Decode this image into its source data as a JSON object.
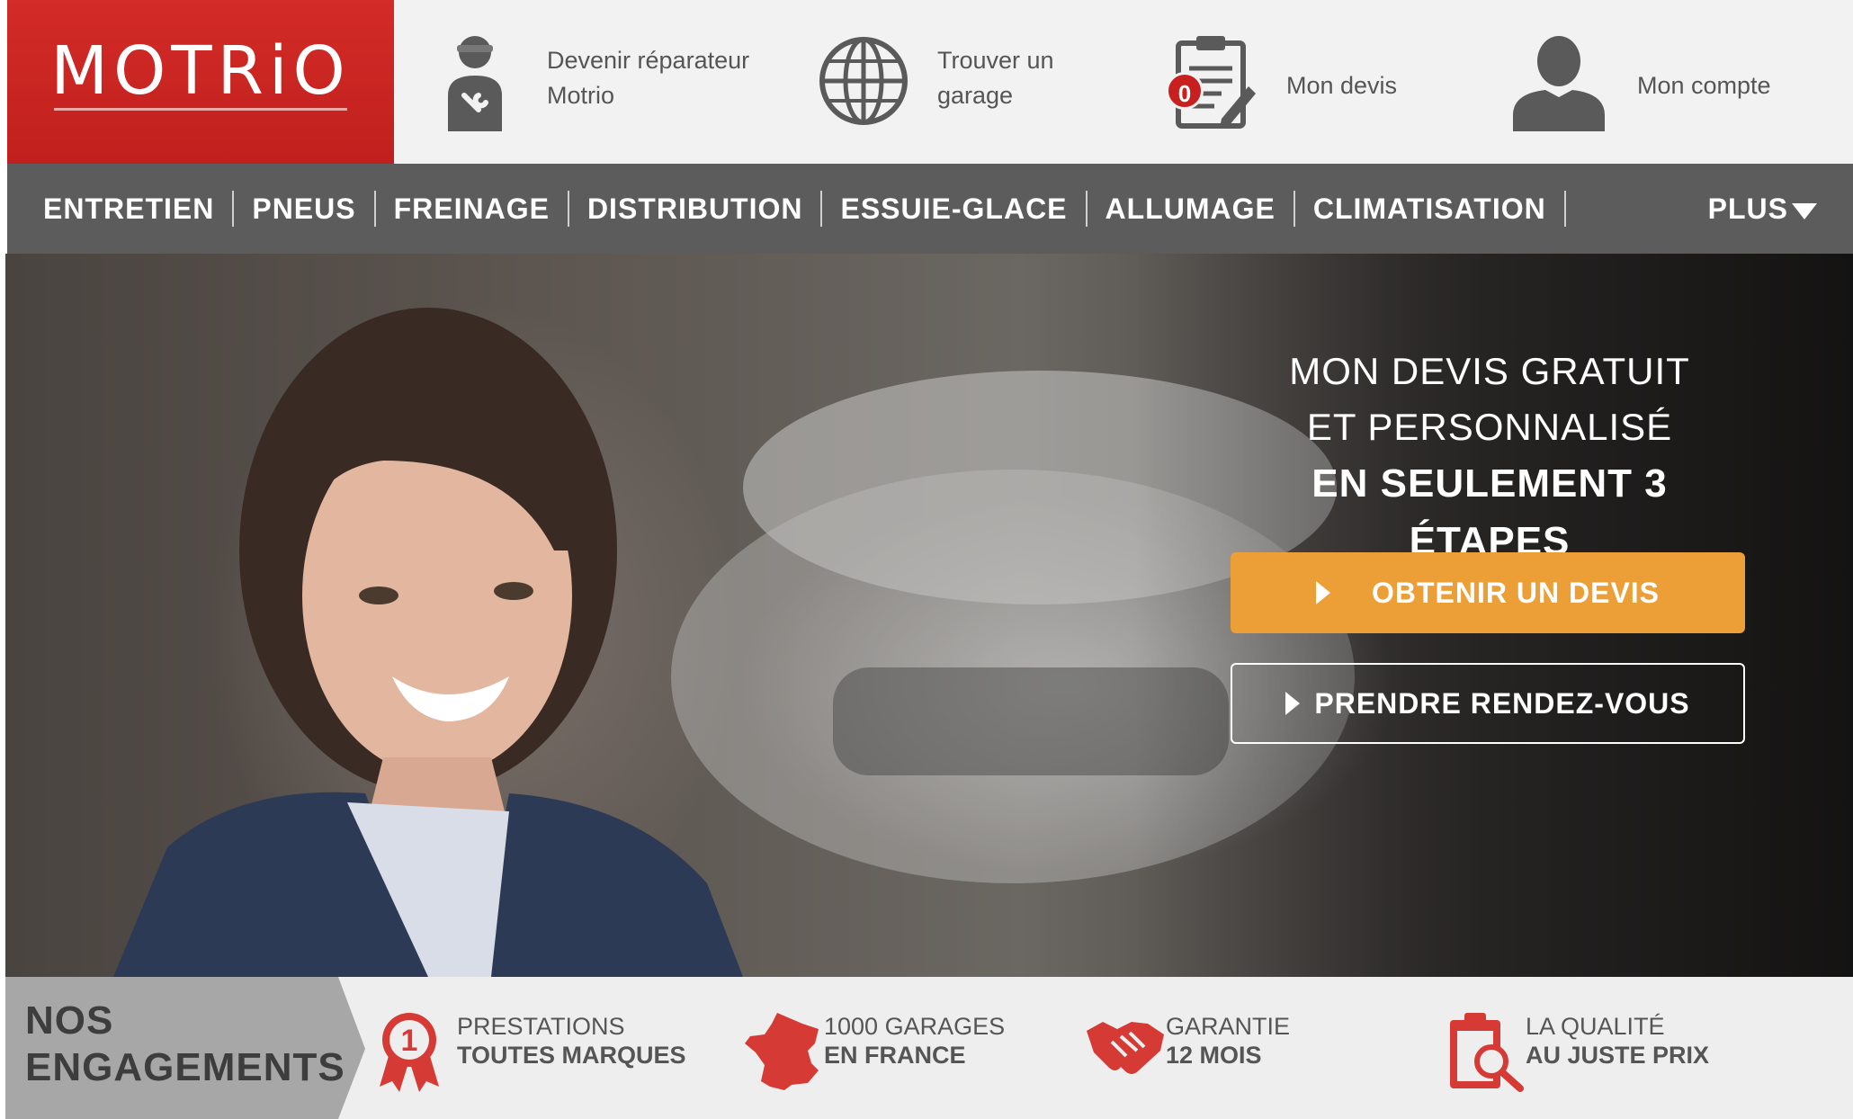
{
  "brand": {
    "logo_text": "MOTRiO"
  },
  "header": {
    "items": [
      {
        "label": "Devenir réparateur Motrio",
        "icon": "mechanic-icon"
      },
      {
        "label": "Trouver un garage",
        "icon": "globe-icon"
      },
      {
        "label": "Mon devis",
        "icon": "clipboard-icon",
        "badge": "0"
      },
      {
        "label": "Mon compte",
        "icon": "user-icon"
      }
    ]
  },
  "nav": {
    "items": [
      "ENTRETIEN",
      "PNEUS",
      "FREINAGE",
      "DISTRIBUTION",
      "ESSUIE-GLACE",
      "ALLUMAGE",
      "CLIMATISATION"
    ],
    "more_label": "PLUS"
  },
  "hero": {
    "line1": "MON DEVIS GRATUIT",
    "line2": "ET PERSONNALISÉ",
    "line3": "EN SEULEMENT 3 ÉTAPES",
    "primary_button": "OBTENIR UN DEVIS",
    "secondary_button": "PRENDRE RENDEZ-VOUS"
  },
  "engagements": {
    "title_line1": "NOS",
    "title_line2": "ENGAGEMENTS",
    "items": [
      {
        "line1": "PRESTATIONS",
        "line2": "TOUTES MARQUES",
        "icon": "award-ribbon-icon"
      },
      {
        "line1": "1000 GARAGES",
        "line2": "EN FRANCE",
        "icon": "france-map-icon"
      },
      {
        "line1": "GARANTIE",
        "line2": "12 MOIS",
        "icon": "handshake-icon"
      },
      {
        "line1": "LA QUALITÉ",
        "line2": "AU JUSTE PRIX",
        "icon": "clipboard-search-icon"
      }
    ]
  },
  "colors": {
    "brand_red": "#c8201e",
    "nav_gray": "#5c5c5c",
    "cta_orange": "#ec9f36",
    "engagement_bg": "#eeeeef"
  }
}
